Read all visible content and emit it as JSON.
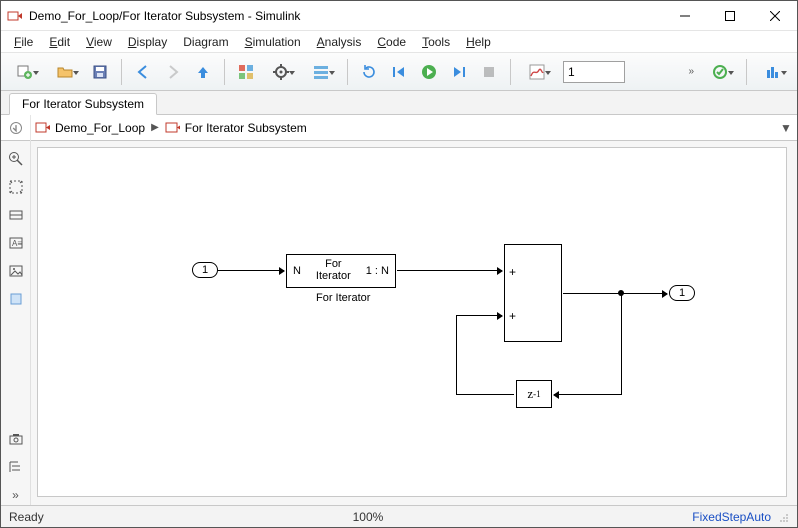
{
  "window": {
    "title": "Demo_For_Loop/For Iterator Subsystem - Simulink"
  },
  "menu": {
    "file": "File",
    "edit": "Edit",
    "view": "View",
    "display": "Display",
    "diagram": "Diagram",
    "simulation": "Simulation",
    "analysis": "Analysis",
    "code": "Code",
    "tools": "Tools",
    "help": "Help"
  },
  "toolbar": {
    "sim_time": "1",
    "overflow": "»"
  },
  "tabs": {
    "active": "For Iterator Subsystem"
  },
  "breadcrumb": {
    "root": "Demo_For_Loop",
    "child": "For Iterator Subsystem"
  },
  "blocks": {
    "inport_num": "1",
    "for_left": "N",
    "for_mid_top": "For",
    "for_mid_bot": "Iterator",
    "for_right": "1 : N",
    "for_label": "For Iterator",
    "sum_p1": "+",
    "sum_p2": "+",
    "delay_z": "z",
    "delay_exp": "-1",
    "outport_num": "1"
  },
  "status": {
    "ready": "Ready",
    "zoom": "100%",
    "solver": "FixedStepAuto"
  }
}
